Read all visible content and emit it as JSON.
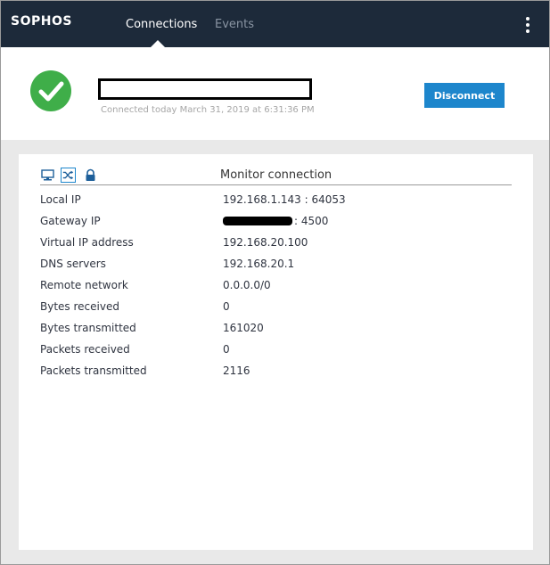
{
  "header": {
    "logo": "SOPHOS",
    "tabs": [
      {
        "label": "Connections",
        "active": true
      },
      {
        "label": "Events",
        "active": false
      }
    ],
    "menu_icon": "more-vertical-icon"
  },
  "status": {
    "state_icon": "check-circle-icon",
    "connected_since": "Connected today March 31, 2019 at 6:31:36 PM",
    "disconnect_label": "Disconnect"
  },
  "monitor": {
    "title": "Monitor connection",
    "icons": [
      "monitor-icon",
      "shuffle-icon",
      "lock-icon"
    ],
    "rows": [
      {
        "label": "Local IP",
        "value": "192.168.1.143 : 64053"
      },
      {
        "label": "Gateway IP",
        "value": ": 4500"
      },
      {
        "label": "Virtual IP address",
        "value": "192.168.20.100"
      },
      {
        "label": "DNS servers",
        "value": "192.168.20.1"
      },
      {
        "label": "Remote network",
        "value": "0.0.0.0/0"
      },
      {
        "label": "Bytes received",
        "value": "0"
      },
      {
        "label": "Bytes transmitted",
        "value": "161020"
      },
      {
        "label": "Packets received",
        "value": "0"
      },
      {
        "label": "Packets transmitted",
        "value": "2116"
      }
    ]
  },
  "colors": {
    "header_bg": "#1d2a3a",
    "accent": "#1d86cc",
    "success": "#3fae49"
  }
}
